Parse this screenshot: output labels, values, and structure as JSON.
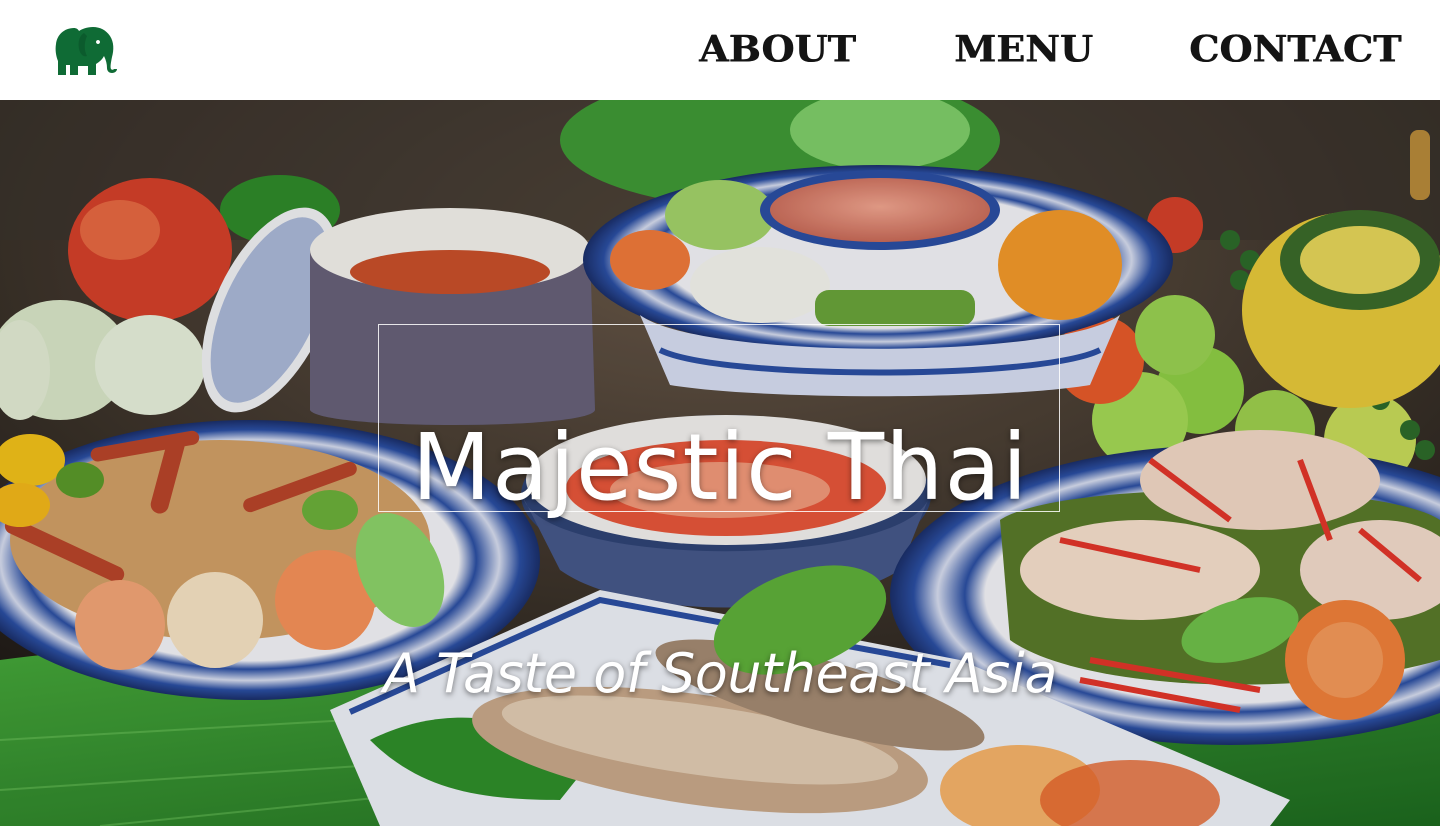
{
  "brand": {
    "logo_icon": "elephant-icon",
    "logo_color": "#0f6b35"
  },
  "nav": {
    "items": [
      {
        "label": "ABOUT"
      },
      {
        "label": "MENU"
      },
      {
        "label": "CONTACT"
      }
    ]
  },
  "hero": {
    "title": "Majestic Thai",
    "tagline": "A Taste of Southeast Asia",
    "background_description_icon": "thai-food-spread-image"
  },
  "colors": {
    "nav_text": "#141414",
    "hero_text": "#ffffff",
    "banana_leaf": "#2f8f2a",
    "ceramic_blue": "#2b4fa3"
  }
}
